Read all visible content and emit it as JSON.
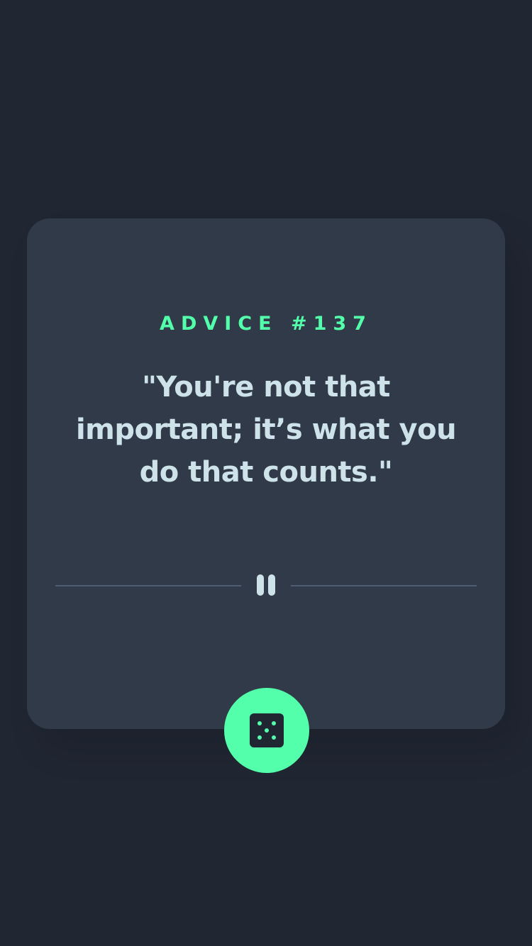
{
  "card": {
    "advice_label": "ADVICE #137",
    "quote": "\"You're not that important; it’s what you do that counts.\""
  },
  "divider": {
    "icon": "pause-icon"
  },
  "action": {
    "icon": "dice-icon",
    "button_color": "#53ffaa"
  },
  "colors": {
    "background": "#202632",
    "card": "#313a48",
    "accent": "#53ffaa",
    "text": "#cee3e9",
    "divider": "#4f5d74"
  }
}
